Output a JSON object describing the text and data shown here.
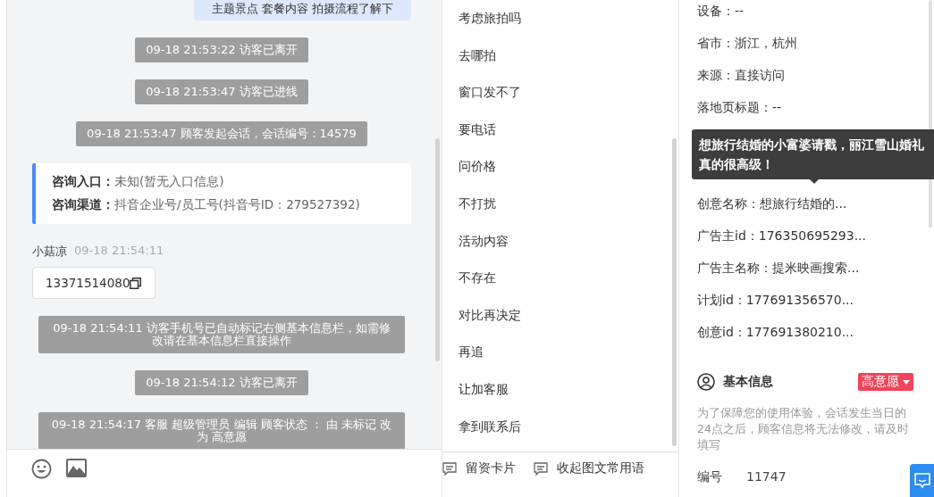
{
  "chat": {
    "messages": [
      {
        "kind": "visitor",
        "text": "主题景点 套餐内容 拍摄流程了解下"
      },
      {
        "kind": "system",
        "text": "09-18 21:53:22 访客已离开"
      },
      {
        "kind": "system",
        "text": "09-18 21:53:47 访客已进线"
      },
      {
        "kind": "system",
        "text": "09-18 21:53:47 顾客发起会话，会话编号：14579"
      },
      {
        "kind": "info",
        "rows": [
          {
            "label": "咨询入口：",
            "value": "未知(暂无入口信息)"
          },
          {
            "label": "咨询渠道：",
            "value": "抖音企业号/员工号(抖音号ID：279527392)"
          }
        ]
      },
      {
        "kind": "agent",
        "name": "小菇凉",
        "time": "09-18 21:54:11",
        "text": "13371514080"
      },
      {
        "kind": "system",
        "text": "09-18 21:54:11 访客手机号已自动标记右侧基本信息栏，如需修改请在基本信息栏直接操作"
      },
      {
        "kind": "system",
        "text": "09-18 21:54:12 访客已离开"
      },
      {
        "kind": "system",
        "text": "09-18 21:54:17 客服 超级管理员 编辑 顾客状态 ： 由 未标记 改为 高意愿"
      }
    ]
  },
  "phrases": [
    "考虑旅拍吗",
    "去哪拍",
    "窗口发不了",
    "要电话",
    "问价格",
    "不打扰",
    "活动内容",
    "不存在",
    "对比再决定",
    "再追",
    "让加客服",
    "拿到联系后"
  ],
  "phrase_actions": [
    "留资卡片",
    "收起图文常用语"
  ],
  "profile": {
    "fields": [
      {
        "text": "设备：--"
      },
      {
        "text": "省市：浙江，杭州"
      },
      {
        "text": "来源：直接访问"
      },
      {
        "text": "落地页标题：--"
      },
      {
        "text": "创意名称：想旅行结婚的..."
      },
      {
        "text": "广告主id：176350695293..."
      },
      {
        "text": "广告主名称：提米映画搜索..."
      },
      {
        "text": "计划id：177691356570..."
      },
      {
        "text": "创意id：177691380210..."
      }
    ],
    "tooltip": "想旅行结婚的小富婆请戳，丽江雪山婚礼真的很高级！",
    "section_title": "基本信息",
    "intent_tag": "高意愿",
    "note": "为了保障您的使用体验，会话发生当日的24点之后，顾客信息将无法修改，请及时填写",
    "id_label": "编号",
    "id_value": "11747"
  }
}
